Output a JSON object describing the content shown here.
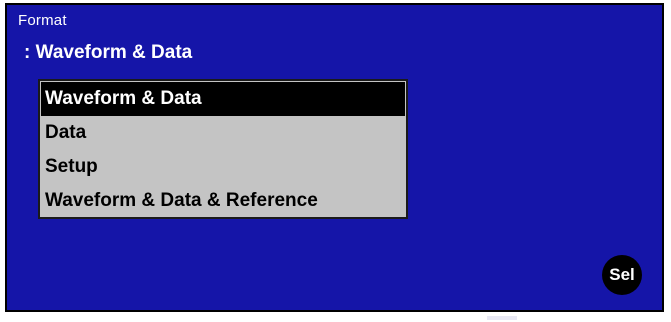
{
  "dialog": {
    "title": "Format",
    "current_prefix": ":",
    "current_value": "Waveform & Data"
  },
  "options": [
    {
      "label": "Waveform & Data",
      "selected": true
    },
    {
      "label": "Data",
      "selected": false
    },
    {
      "label": "Setup",
      "selected": false
    },
    {
      "label": "Waveform & Data & Reference",
      "selected": false
    }
  ],
  "select_button": {
    "label": "Sel"
  },
  "colors": {
    "panel_background": "#1515a8",
    "list_background": "#c4c4c4",
    "selected_background": "#000000",
    "text": "#ffffff"
  }
}
